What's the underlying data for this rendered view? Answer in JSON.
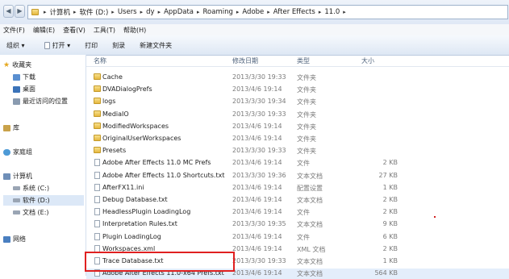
{
  "address": {
    "segments": [
      "计算机",
      "软件 (D:)",
      "Users",
      "dy",
      "AppData",
      "Roaming",
      "Adobe",
      "After Effects",
      "11.0"
    ]
  },
  "menu": [
    "文件(F)",
    "编辑(E)",
    "查看(V)",
    "工具(T)",
    "帮助(H)"
  ],
  "toolbar": {
    "organize": "组织 ▾",
    "open": "打开 ▾",
    "print": "打印",
    "burn": "刻录",
    "new_folder": "新建文件夹"
  },
  "sidebar": {
    "favorites": "收藏夹",
    "downloads": "下载",
    "desktop": "桌面",
    "recent": "最近访问的位置",
    "libraries": "库",
    "homegroup": "家庭组",
    "computer": "计算机",
    "drive_c": "系统 (C:)",
    "drive_d": "软件 (D:)",
    "drive_e": "文档 (E:)",
    "network": "网络"
  },
  "columns": {
    "name": "名称",
    "date": "修改日期",
    "type": "类型",
    "size": "大小"
  },
  "files": [
    {
      "name": "Cache",
      "date": "2013/3/30 19:33",
      "type": "文件夹",
      "size": "",
      "kind": "folder"
    },
    {
      "name": "DVADialogPrefs",
      "date": "2013/4/6 19:14",
      "type": "文件夹",
      "size": "",
      "kind": "folder"
    },
    {
      "name": "logs",
      "date": "2013/3/30 19:34",
      "type": "文件夹",
      "size": "",
      "kind": "folder"
    },
    {
      "name": "MediaIO",
      "date": "2013/3/30 19:33",
      "type": "文件夹",
      "size": "",
      "kind": "folder"
    },
    {
      "name": "ModifiedWorkspaces",
      "date": "2013/4/6 19:14",
      "type": "文件夹",
      "size": "",
      "kind": "folder"
    },
    {
      "name": "OriginalUserWorkspaces",
      "date": "2013/4/6 19:14",
      "type": "文件夹",
      "size": "",
      "kind": "folder"
    },
    {
      "name": "Presets",
      "date": "2013/3/30 19:33",
      "type": "文件夹",
      "size": "",
      "kind": "folder"
    },
    {
      "name": "Adobe After Effects 11.0 MC Prefs",
      "date": "2013/4/6 19:14",
      "type": "文件",
      "size": "2 KB",
      "kind": "file"
    },
    {
      "name": "Adobe After Effects 11.0 Shortcuts.txt",
      "date": "2013/3/30 19:36",
      "type": "文本文档",
      "size": "27 KB",
      "kind": "file"
    },
    {
      "name": "AfterFX11.ini",
      "date": "2013/4/6 19:14",
      "type": "配置设置",
      "size": "1 KB",
      "kind": "file"
    },
    {
      "name": "Debug Database.txt",
      "date": "2013/4/6 19:14",
      "type": "文本文档",
      "size": "2 KB",
      "kind": "file"
    },
    {
      "name": "HeadlessPlugin LoadingLog",
      "date": "2013/4/6 19:14",
      "type": "文件",
      "size": "2 KB",
      "kind": "file"
    },
    {
      "name": "Interpretation Rules.txt",
      "date": "2013/3/30 19:35",
      "type": "文本文档",
      "size": "9 KB",
      "kind": "file"
    },
    {
      "name": "Plugin LoadingLog",
      "date": "2013/4/6 19:14",
      "type": "文件",
      "size": "6 KB",
      "kind": "file"
    },
    {
      "name": "Workspaces.xml",
      "date": "2013/4/6 19:14",
      "type": "XML 文档",
      "size": "2 KB",
      "kind": "file"
    },
    {
      "name": "Trace Database.txt",
      "date": "2013/3/30 19:33",
      "type": "文本文档",
      "size": "1 KB",
      "kind": "file"
    },
    {
      "name": "Adobe After Effects 11.0-x64 Prefs.txt",
      "date": "2013/4/6 19:14",
      "type": "文本文档",
      "size": "564 KB",
      "kind": "file",
      "selected": true
    }
  ],
  "colors": {
    "highlight_box": "#e02020",
    "folder": "#e6b83f",
    "selection": "#e4eefb"
  }
}
